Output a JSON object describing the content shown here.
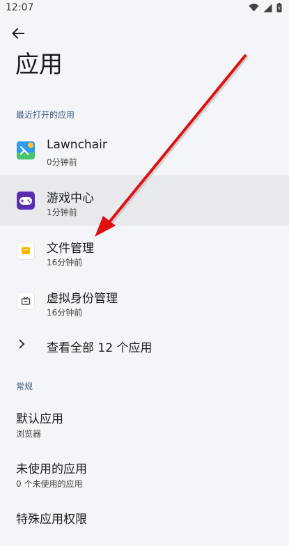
{
  "status_bar": {
    "time": "12:07",
    "icons": [
      "wifi-icon",
      "signal-icon",
      "battery-icon"
    ]
  },
  "header": {
    "back_icon": "arrow-back-icon",
    "title": "应用"
  },
  "recent": {
    "section_label": "最近打开的应用",
    "apps": [
      {
        "name": "Lawnchair",
        "subtitle": "0分钟前",
        "icon": "lawnchair-icon",
        "highlighted": false
      },
      {
        "name": "游戏中心",
        "subtitle": "1分钟前",
        "icon": "game-center-icon",
        "highlighted": true
      },
      {
        "name": "文件管理",
        "subtitle": "16分钟前",
        "icon": "file-manager-icon",
        "highlighted": false
      },
      {
        "name": "虚拟身份管理",
        "subtitle": "16分钟前",
        "icon": "virtual-identity-icon",
        "highlighted": false
      }
    ],
    "view_all_label": "查看全部 12 个应用"
  },
  "general": {
    "section_label": "常规",
    "items": [
      {
        "title": "默认应用",
        "subtitle": "浏览器"
      },
      {
        "title": "未使用的应用",
        "subtitle": "0 个未使用的应用"
      },
      {
        "title": "特殊应用权限",
        "subtitle": ""
      }
    ]
  },
  "colors": {
    "background": "#f4f5f8",
    "highlight_row": "#e8e9ed",
    "section_header": "#3d5a80",
    "annotation_arrow": "#e01010"
  }
}
